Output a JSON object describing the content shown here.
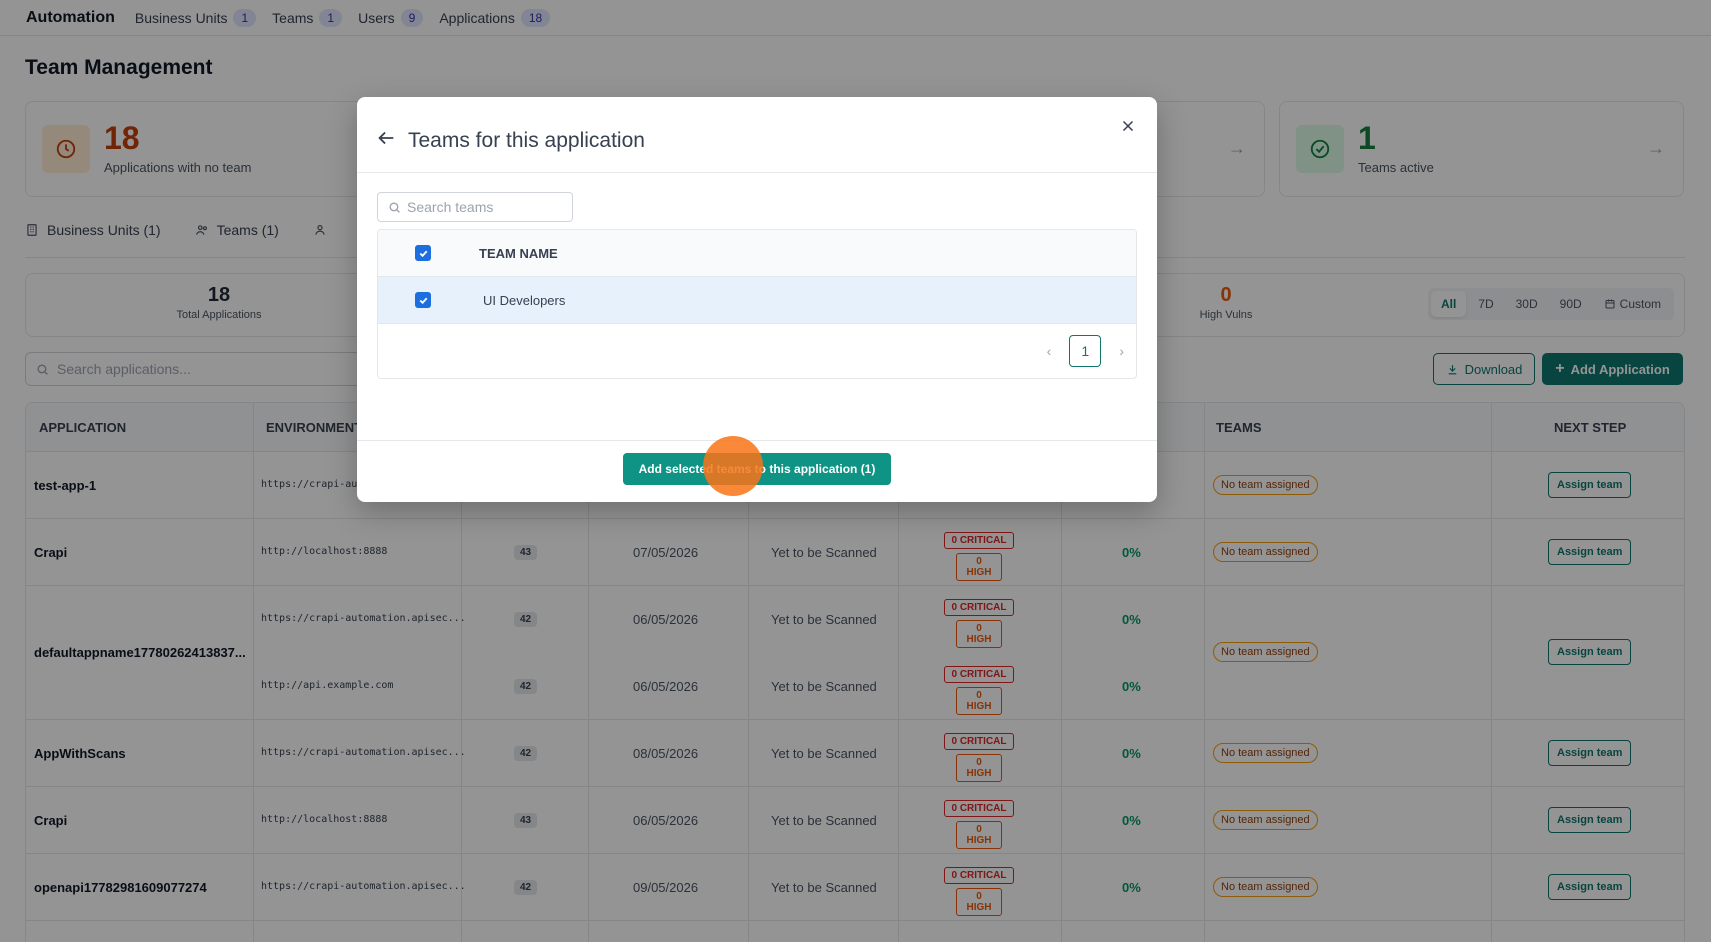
{
  "topnav": {
    "brand": "Automation",
    "items": [
      {
        "label": "Business Units",
        "count": "1"
      },
      {
        "label": "Teams",
        "count": "1"
      },
      {
        "label": "Users",
        "count": "9"
      },
      {
        "label": "Applications",
        "count": "18"
      }
    ]
  },
  "page": {
    "title": "Team Management"
  },
  "cards": [
    {
      "value": "18",
      "label": "Applications with no team",
      "color": "#c2410c"
    },
    {
      "value": "1",
      "label": "Teams active",
      "color": "#15803d"
    }
  ],
  "tabs": [
    {
      "label": "Business Units (1)"
    },
    {
      "label": "Teams (1)"
    }
  ],
  "summary": {
    "total_value": "18",
    "total_label": "Total Applications",
    "high_value": "0",
    "high_label": "High Vulns",
    "ranges": [
      "All",
      "7D",
      "30D",
      "90D",
      "Custom"
    ],
    "active_range": "All"
  },
  "app_search": {
    "placeholder": "Search applications..."
  },
  "actions": {
    "download": "Download",
    "add_application": "Add Application"
  },
  "table": {
    "headers": {
      "application": "Application",
      "environment": "Environment",
      "teams": "Teams",
      "next_step": "Next Step"
    },
    "severity": {
      "critical": "0 CRITICAL",
      "high": "0 HIGH"
    },
    "team_badge": "No team assigned",
    "assign_label": "Assign team",
    "rows": [
      {
        "name": "test-app-1",
        "envs": [
          {
            "url": "https://crapi-aut",
            "ep": "",
            "date": "",
            "status": "",
            "pct": ""
          }
        ]
      },
      {
        "name": "Crapi",
        "envs": [
          {
            "url": "http://localhost:8888",
            "ep": "43",
            "date": "07/05/2026",
            "status": "Yet to be Scanned",
            "pct": "0%"
          }
        ]
      },
      {
        "name": "defaultappname17780262413837...",
        "envs": [
          {
            "url": "https://crapi-automation.apisec...",
            "ep": "42",
            "date": "06/05/2026",
            "status": "Yet to be Scanned",
            "pct": "0%"
          },
          {
            "url": "http://api.example.com",
            "ep": "42",
            "date": "06/05/2026",
            "status": "Yet to be Scanned",
            "pct": "0%"
          }
        ]
      },
      {
        "name": "AppWithScans",
        "envs": [
          {
            "url": "https://crapi-automation.apisec...",
            "ep": "42",
            "date": "08/05/2026",
            "status": "Yet to be Scanned",
            "pct": "0%"
          }
        ]
      },
      {
        "name": "Crapi",
        "envs": [
          {
            "url": "http://localhost:8888",
            "ep": "43",
            "date": "06/05/2026",
            "status": "Yet to be Scanned",
            "pct": "0%"
          }
        ]
      },
      {
        "name": "openapi17782981609077274",
        "envs": [
          {
            "url": "https://crapi-automation.apisec...",
            "ep": "42",
            "date": "09/05/2026",
            "status": "Yet to be Scanned",
            "pct": "0%"
          }
        ]
      }
    ]
  },
  "modal": {
    "title": "Teams for this application",
    "search_placeholder": "Search teams",
    "column": "Team Name",
    "teams": [
      {
        "name": "UI Developers",
        "checked": true
      }
    ],
    "page": "1",
    "submit": "Add selected teams to this application (1)"
  }
}
